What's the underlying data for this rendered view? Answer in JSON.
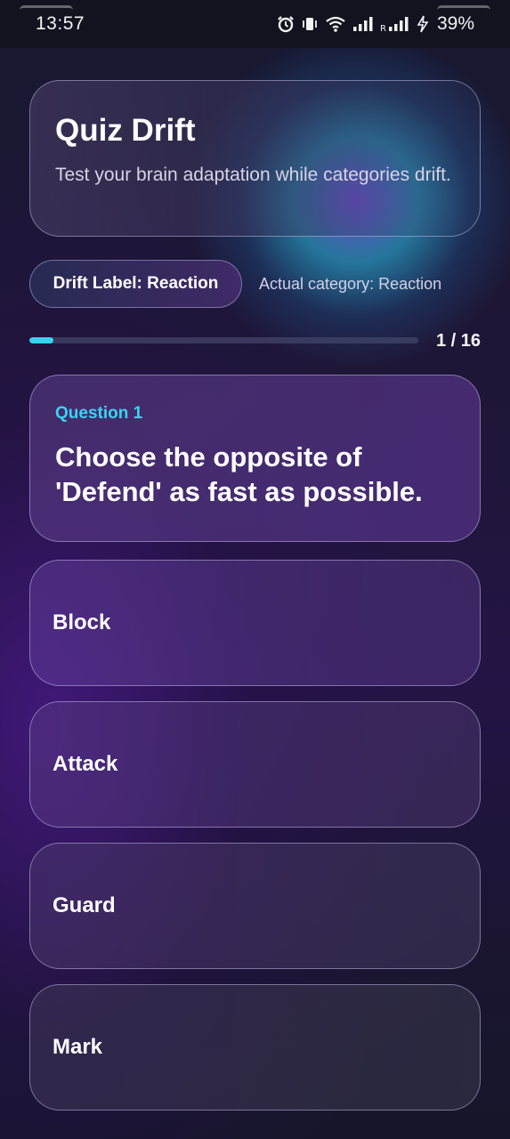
{
  "status_bar": {
    "time": "13:57",
    "battery": "39%",
    "icons": [
      "alarm-icon",
      "vibrate-icon",
      "wifi-icon",
      "signal-icon",
      "signal-roaming-icon",
      "charging-icon"
    ]
  },
  "header": {
    "title": "Quiz Drift",
    "subtitle": "Test your brain adaptation while categories drift."
  },
  "drift": {
    "label": "Drift Label: Reaction",
    "actual": "Actual category: Reaction"
  },
  "progress": {
    "count": "1 / 16",
    "current": 1,
    "total": 16,
    "color": "#39d2f0"
  },
  "question": {
    "number_label": "Question 1",
    "text": "Choose the opposite of 'Defend' as fast as possible."
  },
  "options": [
    {
      "label": "Block"
    },
    {
      "label": "Attack"
    },
    {
      "label": "Guard"
    },
    {
      "label": "Mark"
    }
  ]
}
